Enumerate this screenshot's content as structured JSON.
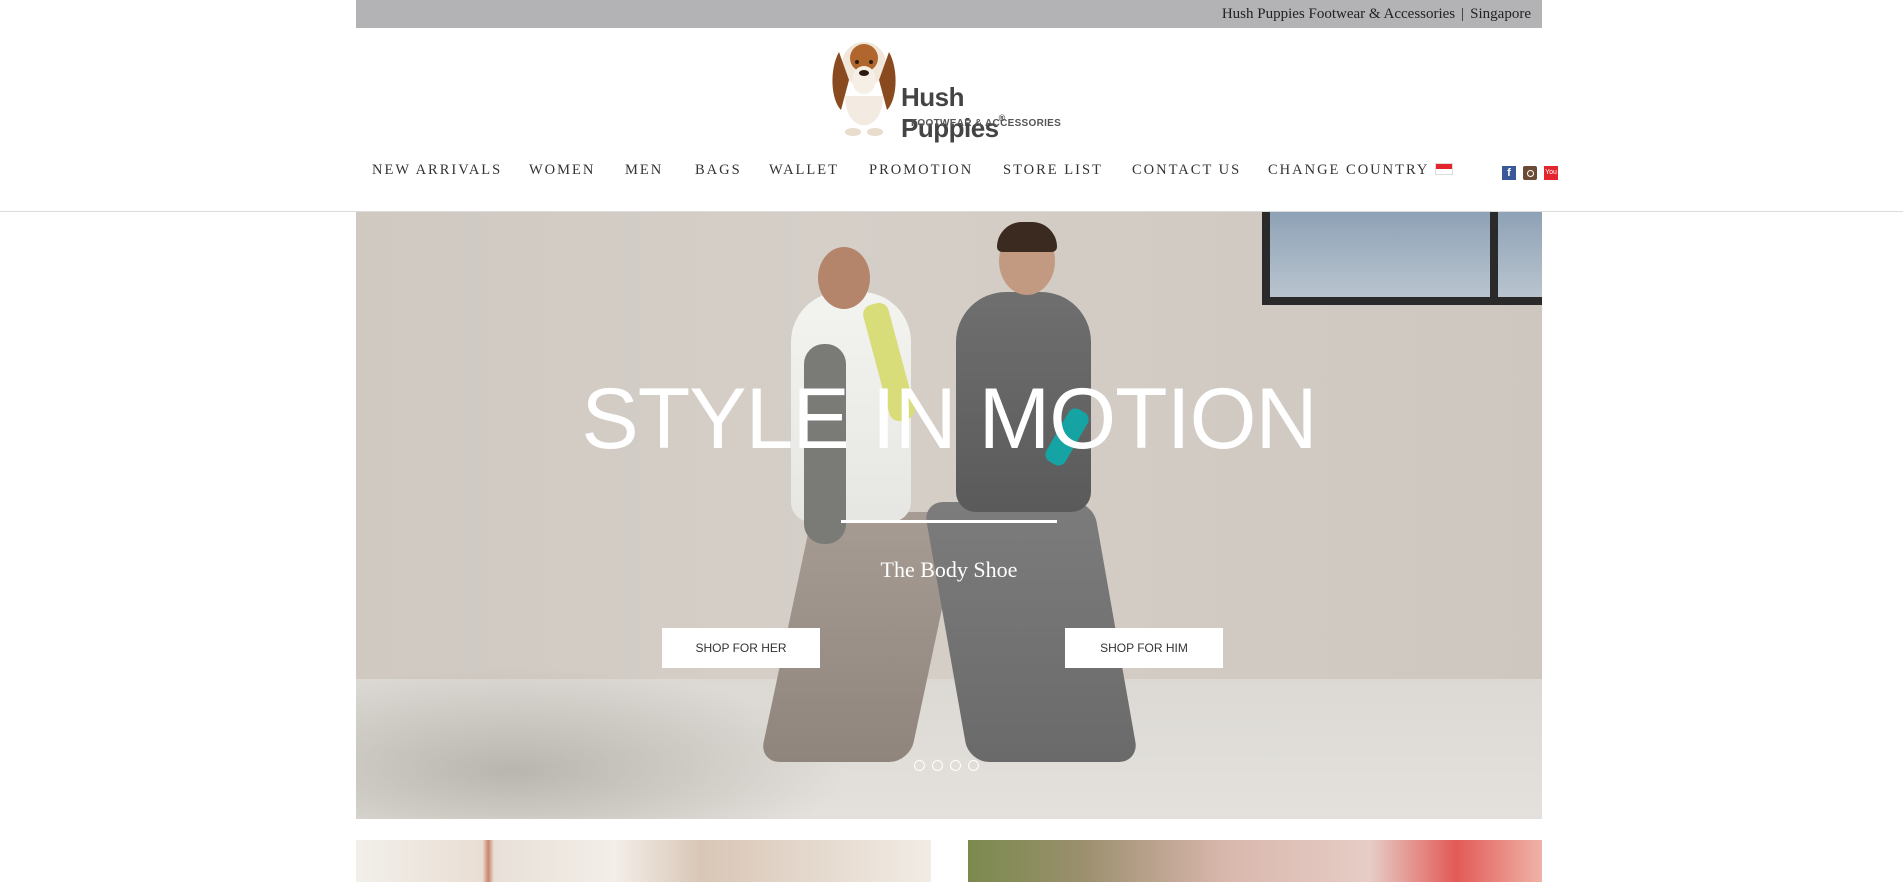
{
  "topbar": {
    "site_name": "Hush Puppies Footwear & Accessories",
    "separator": "|",
    "country": "Singapore"
  },
  "logo": {
    "brand": "Hush Puppies",
    "registered": "®",
    "tagline": "FOOTWEAR & ACCESSORIES"
  },
  "nav": {
    "items": [
      {
        "label": "NEW ARRIVALS"
      },
      {
        "label": "WOMEN"
      },
      {
        "label": "MEN"
      },
      {
        "label": "BAGS"
      },
      {
        "label": "WALLET"
      },
      {
        "label": "PROMOTION"
      },
      {
        "label": "STORE LIST"
      },
      {
        "label": "CONTACT US"
      },
      {
        "label": "CHANGE COUNTRY"
      }
    ],
    "social": [
      {
        "icon": "facebook-icon",
        "glyph": "f"
      },
      {
        "icon": "instagram-icon"
      },
      {
        "icon": "youtube-icon",
        "glyph": "You"
      }
    ]
  },
  "hero": {
    "headline": "STYLE IN MOTION",
    "subline": "The Body Shoe",
    "cta_her": "SHOP FOR HER",
    "cta_him": "SHOP FOR HIM",
    "slides": 4
  },
  "colors": {
    "topbar": "#b3b3b5",
    "flag_red": "#e3242b"
  }
}
